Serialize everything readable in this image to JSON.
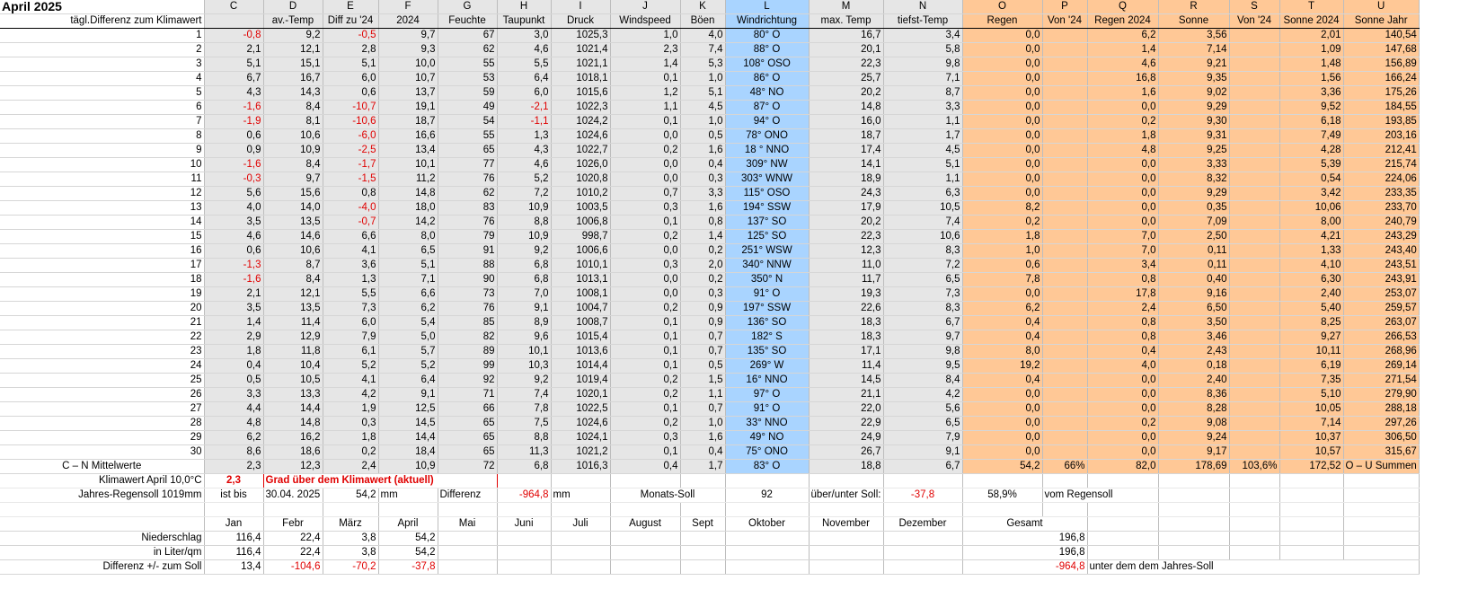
{
  "title": "April 2025",
  "subtitle": "tägl.Differenz zum Klimawert",
  "letters": [
    "C",
    "D",
    "E",
    "F",
    "G",
    "H",
    "I",
    "J",
    "K",
    "L",
    "M",
    "N",
    "O",
    "P",
    "Q",
    "R",
    "S",
    "T",
    "U"
  ],
  "columns": [
    "",
    "av.-Temp",
    "Diff zu '24",
    "2024",
    "Feuchte",
    "Taupunkt",
    "Druck",
    "Windspeed",
    "Böen",
    "Windrichtung",
    "max. Temp",
    "tiefst-Temp",
    "Regen",
    "Von '24",
    "Regen 2024",
    "Sonne",
    "Von '24",
    "Sonne 2024",
    "Sonne Jahr"
  ],
  "rows": [
    [
      "1",
      "-0,8",
      "9,2",
      "-0,5",
      "9,7",
      "67",
      "3,0",
      "1025,3",
      "1,0",
      "4,0",
      "80° O",
      "16,7",
      "3,4",
      "0,0",
      "",
      "6,2",
      "3,56",
      "",
      "2,01",
      "140,54"
    ],
    [
      "2",
      "2,1",
      "12,1",
      "2,8",
      "9,3",
      "62",
      "4,6",
      "1021,4",
      "2,3",
      "7,4",
      "88° O",
      "20,1",
      "5,8",
      "0,0",
      "",
      "1,4",
      "7,14",
      "",
      "1,09",
      "147,68"
    ],
    [
      "3",
      "5,1",
      "15,1",
      "5,1",
      "10,0",
      "55",
      "5,5",
      "1021,1",
      "1,4",
      "5,3",
      "108° OSO",
      "22,3",
      "9,8",
      "0,0",
      "",
      "4,6",
      "9,21",
      "",
      "1,48",
      "156,89"
    ],
    [
      "4",
      "6,7",
      "16,7",
      "6,0",
      "10,7",
      "53",
      "6,4",
      "1018,1",
      "0,1",
      "1,0",
      "86° O",
      "25,7",
      "7,1",
      "0,0",
      "",
      "16,8",
      "9,35",
      "",
      "1,56",
      "166,24"
    ],
    [
      "5",
      "4,3",
      "14,3",
      "0,6",
      "13,7",
      "59",
      "6,0",
      "1015,6",
      "1,2",
      "5,1",
      "48° NO",
      "20,2",
      "8,7",
      "0,0",
      "",
      "1,6",
      "9,02",
      "",
      "3,36",
      "175,26"
    ],
    [
      "6",
      "-1,6",
      "8,4",
      "-10,7",
      "19,1",
      "49",
      "-2,1",
      "1022,3",
      "1,1",
      "4,5",
      "87° O",
      "14,8",
      "3,3",
      "0,0",
      "",
      "0,0",
      "9,29",
      "",
      "9,52",
      "184,55"
    ],
    [
      "7",
      "-1,9",
      "8,1",
      "-10,6",
      "18,7",
      "54",
      "-1,1",
      "1024,2",
      "0,1",
      "1,0",
      "94° O",
      "16,0",
      "1,1",
      "0,0",
      "",
      "0,2",
      "9,30",
      "",
      "6,18",
      "193,85"
    ],
    [
      "8",
      "0,6",
      "10,6",
      "-6,0",
      "16,6",
      "55",
      "1,3",
      "1024,6",
      "0,0",
      "0,5",
      "78° ONO",
      "18,7",
      "1,7",
      "0,0",
      "",
      "1,8",
      "9,31",
      "",
      "7,49",
      "203,16"
    ],
    [
      "9",
      "0,9",
      "10,9",
      "-2,5",
      "13,4",
      "65",
      "4,3",
      "1022,7",
      "0,2",
      "1,6",
      "18 ° NNO",
      "17,4",
      "4,5",
      "0,0",
      "",
      "4,8",
      "9,25",
      "",
      "4,28",
      "212,41"
    ],
    [
      "10",
      "-1,6",
      "8,4",
      "-1,7",
      "10,1",
      "77",
      "4,6",
      "1026,0",
      "0,0",
      "0,4",
      "309° NW",
      "14,1",
      "5,1",
      "0,0",
      "",
      "0,0",
      "3,33",
      "",
      "5,39",
      "215,74"
    ],
    [
      "11",
      "-0,3",
      "9,7",
      "-1,5",
      "11,2",
      "76",
      "5,2",
      "1020,8",
      "0,0",
      "0,3",
      "303° WNW",
      "18,9",
      "1,1",
      "0,0",
      "",
      "0,0",
      "8,32",
      "",
      "0,54",
      "224,06"
    ],
    [
      "12",
      "5,6",
      "15,6",
      "0,8",
      "14,8",
      "62",
      "7,2",
      "1010,2",
      "0,7",
      "3,3",
      "115° OSO",
      "24,3",
      "6,3",
      "0,0",
      "",
      "0,0",
      "9,29",
      "",
      "3,42",
      "233,35"
    ],
    [
      "13",
      "4,0",
      "14,0",
      "-4,0",
      "18,0",
      "83",
      "10,9",
      "1003,5",
      "0,3",
      "1,6",
      "194° SSW",
      "17,9",
      "10,5",
      "8,2",
      "",
      "0,0",
      "0,35",
      "",
      "10,06",
      "233,70"
    ],
    [
      "14",
      "3,5",
      "13,5",
      "-0,7",
      "14,2",
      "76",
      "8,8",
      "1006,8",
      "0,1",
      "0,8",
      "137° SO",
      "20,2",
      "7,4",
      "0,2",
      "",
      "0,0",
      "7,09",
      "",
      "8,00",
      "240,79"
    ],
    [
      "15",
      "4,6",
      "14,6",
      "6,6",
      "8,0",
      "79",
      "10,9",
      "998,7",
      "0,2",
      "1,4",
      "125° SO",
      "22,3",
      "10,6",
      "1,8",
      "",
      "7,0",
      "2,50",
      "",
      "4,21",
      "243,29"
    ],
    [
      "16",
      "0,6",
      "10,6",
      "4,1",
      "6,5",
      "91",
      "9,2",
      "1006,6",
      "0,0",
      "0,2",
      "251° WSW",
      "12,3",
      "8,3",
      "1,0",
      "",
      "7,0",
      "0,11",
      "",
      "1,33",
      "243,40"
    ],
    [
      "17",
      "-1,3",
      "8,7",
      "3,6",
      "5,1",
      "88",
      "6,8",
      "1010,1",
      "0,3",
      "2,0",
      "340° NNW",
      "11,0",
      "7,2",
      "0,6",
      "",
      "3,4",
      "0,11",
      "",
      "4,10",
      "243,51"
    ],
    [
      "18",
      "-1,6",
      "8,4",
      "1,3",
      "7,1",
      "90",
      "6,8",
      "1013,1",
      "0,0",
      "0,2",
      "350° N",
      "11,7",
      "6,5",
      "7,8",
      "",
      "0,8",
      "0,40",
      "",
      "6,30",
      "243,91"
    ],
    [
      "19",
      "2,1",
      "12,1",
      "5,5",
      "6,6",
      "73",
      "7,0",
      "1008,1",
      "0,0",
      "0,3",
      "91° O",
      "19,3",
      "7,3",
      "0,0",
      "",
      "17,8",
      "9,16",
      "",
      "2,40",
      "253,07"
    ],
    [
      "20",
      "3,5",
      "13,5",
      "7,3",
      "6,2",
      "76",
      "9,1",
      "1004,7",
      "0,2",
      "0,9",
      "197° SSW",
      "22,6",
      "8,3",
      "6,2",
      "",
      "2,4",
      "6,50",
      "",
      "5,40",
      "259,57"
    ],
    [
      "21",
      "1,4",
      "11,4",
      "6,0",
      "5,4",
      "85",
      "8,9",
      "1008,7",
      "0,1",
      "0,9",
      "136° SO",
      "18,3",
      "6,7",
      "0,4",
      "",
      "0,8",
      "3,50",
      "",
      "8,25",
      "263,07"
    ],
    [
      "22",
      "2,9",
      "12,9",
      "7,9",
      "5,0",
      "82",
      "9,6",
      "1015,4",
      "0,1",
      "0,7",
      "182° S",
      "18,3",
      "9,7",
      "0,4",
      "",
      "0,8",
      "3,46",
      "",
      "9,27",
      "266,53"
    ],
    [
      "23",
      "1,8",
      "11,8",
      "6,1",
      "5,7",
      "89",
      "10,1",
      "1013,6",
      "0,1",
      "0,7",
      "135° SO",
      "17,1",
      "9,8",
      "8,0",
      "",
      "0,4",
      "2,43",
      "",
      "10,11",
      "268,96"
    ],
    [
      "24",
      "0,4",
      "10,4",
      "5,2",
      "5,2",
      "99",
      "10,3",
      "1014,4",
      "0,1",
      "0,5",
      "269° W",
      "11,4",
      "9,5",
      "19,2",
      "",
      "4,0",
      "0,18",
      "",
      "6,19",
      "269,14"
    ],
    [
      "25",
      "0,5",
      "10,5",
      "4,1",
      "6,4",
      "92",
      "9,2",
      "1019,4",
      "0,2",
      "1,5",
      "16° NNO",
      "14,5",
      "8,4",
      "0,4",
      "",
      "0,0",
      "2,40",
      "",
      "7,35",
      "271,54"
    ],
    [
      "26",
      "3,3",
      "13,3",
      "4,2",
      "9,1",
      "71",
      "7,4",
      "1020,1",
      "0,2",
      "1,1",
      "97° O",
      "21,1",
      "4,2",
      "0,0",
      "",
      "0,0",
      "8,36",
      "",
      "5,10",
      "279,90"
    ],
    [
      "27",
      "4,4",
      "14,4",
      "1,9",
      "12,5",
      "66",
      "7,8",
      "1022,5",
      "0,1",
      "0,7",
      "91° O",
      "22,0",
      "5,6",
      "0,0",
      "",
      "0,0",
      "8,28",
      "",
      "10,05",
      "288,18"
    ],
    [
      "28",
      "4,8",
      "14,8",
      "0,3",
      "14,5",
      "65",
      "7,5",
      "1024,6",
      "0,2",
      "1,0",
      "33° NNO",
      "22,9",
      "6,5",
      "0,0",
      "",
      "0,2",
      "9,08",
      "",
      "7,14",
      "297,26"
    ],
    [
      "29",
      "6,2",
      "16,2",
      "1,8",
      "14,4",
      "65",
      "8,8",
      "1024,1",
      "0,3",
      "1,6",
      "49° NO",
      "24,9",
      "7,9",
      "0,0",
      "",
      "0,0",
      "9,24",
      "",
      "10,37",
      "306,50"
    ],
    [
      "30",
      "8,6",
      "18,6",
      "0,2",
      "18,4",
      "65",
      "11,3",
      "1021,2",
      "0,1",
      "0,4",
      "75° ONO",
      "26,7",
      "9,1",
      "0,0",
      "",
      "0,0",
      "9,17",
      "",
      "10,57",
      "315,67"
    ]
  ],
  "means": {
    "label": "C – N Mittelwerte",
    "values": [
      "2,3",
      "12,3",
      "2,4",
      "10,9",
      "72",
      "6,8",
      "1016,3",
      "0,4",
      "1,7",
      "83° O",
      "18,8",
      "6,7",
      "54,2",
      "66%",
      "82,0",
      "178,69",
      "103,6%",
      "172,52"
    ],
    "sums_label": "O – U Summen"
  },
  "klima": {
    "label": "Klimawert April 10,0°C",
    "value": "2,3",
    "text": "Grad über dem Klimawert (aktuell)"
  },
  "regen": {
    "label": "Jahres-Regensoll 1019mm",
    "bis": "ist bis",
    "date": "30.04. 2025",
    "amount": "54,2",
    "unit": "mm",
    "diff_label": "Differenz",
    "diff": "-964,8",
    "diff_unit": "mm",
    "monats_label": "Monats-Soll",
    "monats": "92",
    "soll_label": "über/unter Soll:",
    "soll": "-37,8",
    "pct": "58,9%",
    "vom": "vom Regensoll"
  },
  "months": [
    "Jan",
    "Febr",
    "März",
    "April",
    "Mai",
    "Juni",
    "Juli",
    "August",
    "Sept",
    "Oktober",
    "November",
    "Dezember",
    "Gesamt"
  ],
  "niederschlag": {
    "label": "Niederschlag",
    "values": [
      "116,4",
      "22,4",
      "3,8",
      "54,2"
    ],
    "total": "196,8"
  },
  "liter": {
    "label": "in Liter/qm",
    "values": [
      "116,4",
      "22,4",
      "3,8",
      "54,2"
    ],
    "total": "196,8"
  },
  "differenz": {
    "label": "Differenz  +/- zum Soll",
    "values": [
      "13,4",
      "-104,6",
      "-70,2",
      "-37,8"
    ],
    "total": "-964,8",
    "note": "unter dem dem Jahres-Soll"
  }
}
